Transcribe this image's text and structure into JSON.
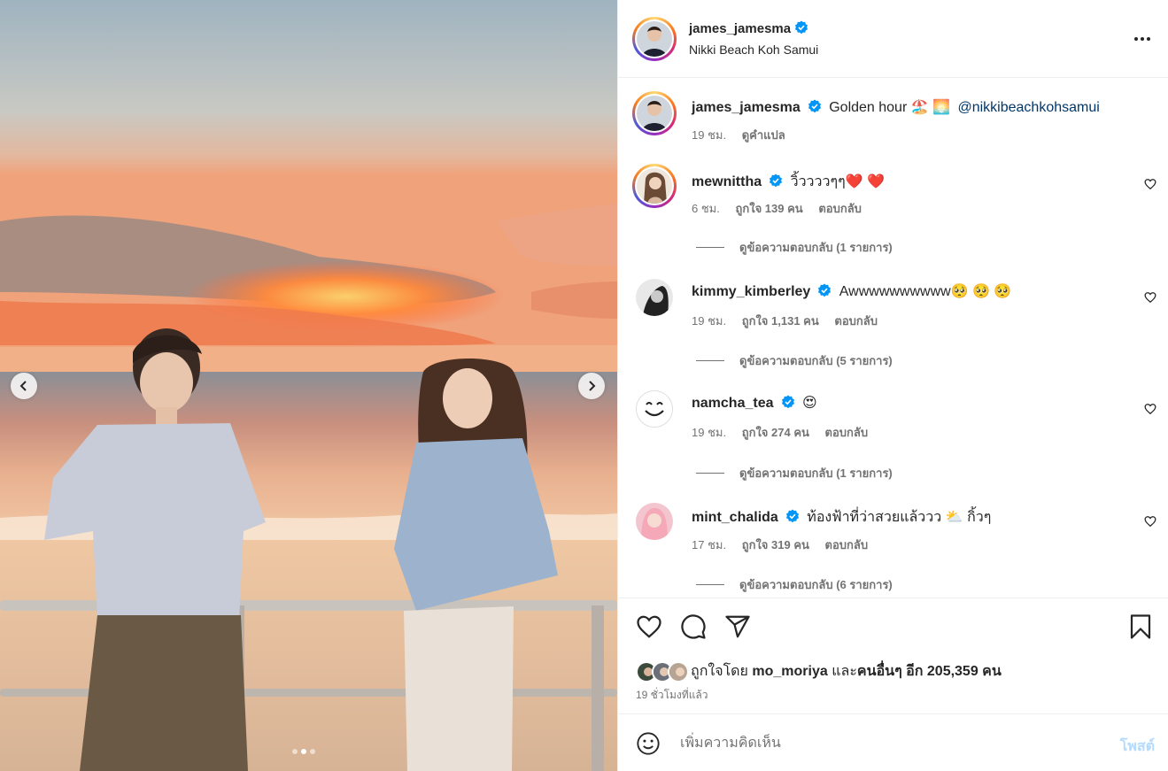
{
  "post": {
    "author": "james_jamesma",
    "location": "Nikki Beach Koh Samui",
    "caption": {
      "username": "james_jamesma",
      "text": "Golden hour 🏖️ 🌅",
      "mention": "@nikkibeachkohsamui",
      "time": "19 ชม.",
      "translate": "ดูคำแปล"
    },
    "carousel": {
      "slides": 3,
      "active_slide": 2
    }
  },
  "comments": [
    {
      "username": "mewnittha",
      "text": "วิ้ววววๆๆ❤️ ❤️",
      "time": "6 ชม.",
      "likes": "ถูกใจ 139 คน",
      "reply": "ตอบกลับ",
      "view_replies": "ดูข้อความตอบกลับ (1 รายการ)"
    },
    {
      "username": "kimmy_kimberley",
      "text": "Awwwwwwwwww🥺 🥺 🥺",
      "time": "19 ชม.",
      "likes": "ถูกใจ 1,131 คน",
      "reply": "ตอบกลับ",
      "view_replies": "ดูข้อความตอบกลับ (5 รายการ)"
    },
    {
      "username": "namcha_tea",
      "text": "😍",
      "time": "19 ชม.",
      "likes": "ถูกใจ 274 คน",
      "reply": "ตอบกลับ",
      "view_replies": "ดูข้อความตอบกลับ (1 รายการ)"
    },
    {
      "username": "mint_chalida",
      "text": "ท้องฟ้าที่ว่าสวยแล้ววว ⛅ กิ้วๆ",
      "time": "17 ชม.",
      "likes": "ถูกใจ 319 คน",
      "reply": "ตอบกลับ",
      "view_replies": "ดูข้อความตอบกลับ (6 รายการ)"
    }
  ],
  "likes": {
    "prefix": "ถูกใจโดย",
    "user": "mo_moriya",
    "conj": "และ",
    "others": "คนอื่นๆ อีก 205,359 คน"
  },
  "time_ago": "19 ชั่วโมงที่แล้ว",
  "composer": {
    "placeholder": "เพิ่มความคิดเห็น",
    "post_label": "โพสต์"
  },
  "icons": {
    "verified": "verified-badge-icon",
    "more": "more-options-icon",
    "like": "heart-icon",
    "comment": "comment-icon",
    "share": "share-icon",
    "save": "bookmark-icon",
    "emoji": "emoji-icon",
    "prev": "chevron-left-icon",
    "next": "chevron-right-icon"
  },
  "colors": {
    "verified": "#0095f6",
    "link": "#00376b",
    "secondary_text": "#737373",
    "post_disabled": "#b3dbff"
  }
}
